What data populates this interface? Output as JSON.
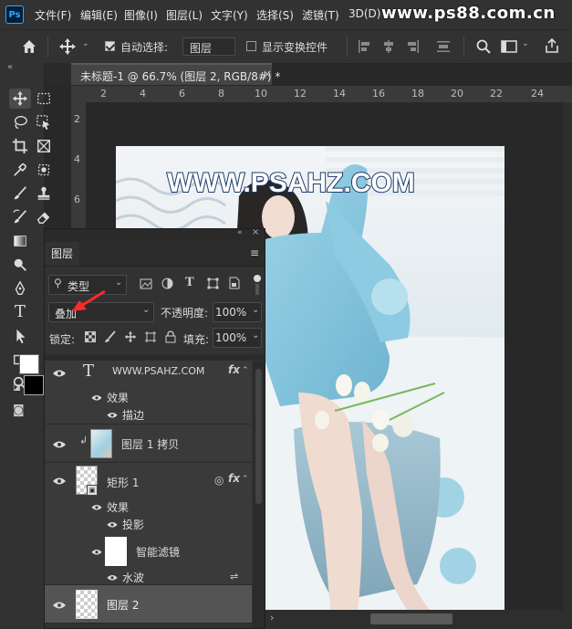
{
  "app": {
    "logo_text": "Ps",
    "watermark": "www.ps88.com.cn"
  },
  "menu": [
    "文件(F)",
    "编辑(E)",
    "图像(I)",
    "图层(L)",
    "文字(Y)",
    "选择(S)",
    "滤镜(T)",
    "3D(D)"
  ],
  "options": {
    "auto_select_label": "自动选择:",
    "auto_select_checked": true,
    "auto_select_target": "图层",
    "show_transform_label": "显示变换控件",
    "show_transform_checked": false
  },
  "document": {
    "title": "未标题-1 @ 66.7% (图层 2, RGB/8#) *",
    "close": "×"
  },
  "ruler_top": [
    "2",
    "4",
    "6",
    "8",
    "10",
    "12",
    "14",
    "16",
    "18",
    "20",
    "22",
    "24"
  ],
  "ruler_left": [
    "2",
    "4",
    "6",
    "8"
  ],
  "canvas_text": "WWW.PSAHZ.COM",
  "layers_panel": {
    "tab_label": "图层",
    "filter_kind": "类型",
    "blend_mode": "叠加",
    "opacity_label": "不透明度:",
    "opacity_value": "100%",
    "lock_label": "锁定:",
    "fill_label": "填充:",
    "fill_value": "100%",
    "layers": {
      "text_layer": {
        "name": "WWW.PSAHZ.COM",
        "fx": "fx",
        "effects_label": "效果",
        "effect": "描边"
      },
      "copy_layer": {
        "name": "图层 1 拷贝"
      },
      "shape_layer": {
        "name": "矩形 1",
        "fx": "fx",
        "effects_label": "效果",
        "effect": "投影",
        "smart_filters": "智能滤镜",
        "filter": "水波"
      },
      "layer2": {
        "name": "图层 2"
      }
    }
  },
  "colors": {
    "accent": "#31a8ff",
    "annotation_arrow": "#ff2a2a",
    "panel": "#323232"
  }
}
